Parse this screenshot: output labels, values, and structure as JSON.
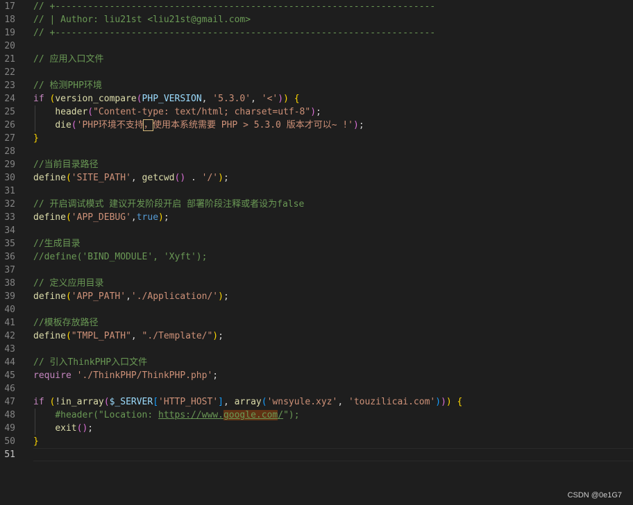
{
  "editor": {
    "watermark": "CSDN @0e1G7",
    "lines": [
      {
        "n": "17",
        "tokens": [
          [
            "c",
            "// +----------------------------------------------------------------------"
          ]
        ]
      },
      {
        "n": "18",
        "tokens": [
          [
            "c",
            "// | Author: liu21st <liu21st@gmail.com>"
          ]
        ]
      },
      {
        "n": "19",
        "tokens": [
          [
            "c",
            "// +----------------------------------------------------------------------"
          ]
        ]
      },
      {
        "n": "20",
        "tokens": []
      },
      {
        "n": "21",
        "tokens": [
          [
            "c",
            "// 应用入口文件"
          ]
        ]
      },
      {
        "n": "22",
        "tokens": []
      },
      {
        "n": "23",
        "tokens": [
          [
            "c",
            "// 检测PHP环境"
          ]
        ]
      },
      {
        "n": "24",
        "tokens": [
          [
            "k",
            "if"
          ],
          [
            "p",
            " "
          ],
          [
            "b1",
            "("
          ],
          [
            "f",
            "version_compare"
          ],
          [
            "b2",
            "("
          ],
          [
            "v",
            "PHP_VERSION"
          ],
          [
            "p",
            ", "
          ],
          [
            "s",
            "'5.3.0'"
          ],
          [
            "p",
            ", "
          ],
          [
            "s",
            "'<'"
          ],
          [
            "b2",
            ")"
          ],
          [
            "b1",
            ")"
          ],
          [
            "p",
            " "
          ],
          [
            "b1",
            "{"
          ]
        ]
      },
      {
        "n": "25",
        "guide": true,
        "tokens": [
          [
            "p",
            "    "
          ],
          [
            "f",
            "header"
          ],
          [
            "b2",
            "("
          ],
          [
            "s",
            "\"Content-type: text/html; charset=utf-8\""
          ],
          [
            "b2",
            ")"
          ],
          [
            "p",
            ";"
          ]
        ]
      },
      {
        "n": "26",
        "guide": true,
        "tokens": [
          [
            "p",
            "    "
          ],
          [
            "f",
            "die"
          ],
          [
            "b2",
            "("
          ],
          [
            "s",
            "'PHP环境不支持"
          ],
          [
            "s selbox",
            "，"
          ],
          [
            "s",
            "使用本系统需要 PHP > 5.3.0 版本才可以~ !'"
          ],
          [
            "b2",
            ")"
          ],
          [
            "p",
            ";"
          ]
        ]
      },
      {
        "n": "27",
        "tokens": [
          [
            "b1",
            "}"
          ]
        ]
      },
      {
        "n": "28",
        "tokens": []
      },
      {
        "n": "29",
        "tokens": [
          [
            "c",
            "//当前目录路径"
          ]
        ]
      },
      {
        "n": "30",
        "tokens": [
          [
            "f",
            "define"
          ],
          [
            "b1",
            "("
          ],
          [
            "s",
            "'SITE_PATH'"
          ],
          [
            "p",
            ", "
          ],
          [
            "f",
            "getcwd"
          ],
          [
            "b2",
            "()"
          ],
          [
            "p",
            " . "
          ],
          [
            "s",
            "'/'"
          ],
          [
            "b1",
            ")"
          ],
          [
            "p",
            ";"
          ]
        ]
      },
      {
        "n": "31",
        "tokens": []
      },
      {
        "n": "32",
        "tokens": [
          [
            "c",
            "// 开启调试模式 建议开发阶段开启 部署阶段注释或者设为false"
          ]
        ]
      },
      {
        "n": "33",
        "tokens": [
          [
            "f",
            "define"
          ],
          [
            "b1",
            "("
          ],
          [
            "s",
            "'APP_DEBUG'"
          ],
          [
            "p",
            ","
          ],
          [
            "kb",
            "true"
          ],
          [
            "b1",
            ")"
          ],
          [
            "p",
            ";"
          ]
        ]
      },
      {
        "n": "34",
        "tokens": []
      },
      {
        "n": "35",
        "tokens": [
          [
            "c",
            "//生成目录"
          ]
        ]
      },
      {
        "n": "36",
        "tokens": [
          [
            "c",
            "//define('BIND_MODULE', 'Xyft');"
          ]
        ]
      },
      {
        "n": "37",
        "tokens": []
      },
      {
        "n": "38",
        "tokens": [
          [
            "c",
            "// 定义应用目录"
          ]
        ]
      },
      {
        "n": "39",
        "tokens": [
          [
            "f",
            "define"
          ],
          [
            "b1",
            "("
          ],
          [
            "s",
            "'APP_PATH'"
          ],
          [
            "p",
            ","
          ],
          [
            "s",
            "'./Application/'"
          ],
          [
            "b1",
            ")"
          ],
          [
            "p",
            ";"
          ]
        ]
      },
      {
        "n": "40",
        "tokens": []
      },
      {
        "n": "41",
        "tokens": [
          [
            "c",
            "//模板存放路径"
          ]
        ]
      },
      {
        "n": "42",
        "tokens": [
          [
            "f",
            "define"
          ],
          [
            "b1",
            "("
          ],
          [
            "s",
            "\"TMPL_PATH\""
          ],
          [
            "p",
            ", "
          ],
          [
            "s",
            "\"./Template/\""
          ],
          [
            "b1",
            ")"
          ],
          [
            "p",
            ";"
          ]
        ]
      },
      {
        "n": "43",
        "tokens": []
      },
      {
        "n": "44",
        "tokens": [
          [
            "c",
            "// 引入ThinkPHP入口文件"
          ]
        ]
      },
      {
        "n": "45",
        "tokens": [
          [
            "k",
            "require"
          ],
          [
            "p",
            " "
          ],
          [
            "s",
            "'./ThinkPHP/ThinkPHP.php'"
          ],
          [
            "p",
            ";"
          ]
        ]
      },
      {
        "n": "46",
        "tokens": []
      },
      {
        "n": "47",
        "tokens": [
          [
            "k",
            "if"
          ],
          [
            "p",
            " "
          ],
          [
            "b1",
            "("
          ],
          [
            "p",
            "!"
          ],
          [
            "f",
            "in_array"
          ],
          [
            "b2",
            "("
          ],
          [
            "v",
            "$_SERVER"
          ],
          [
            "b3",
            "["
          ],
          [
            "s",
            "'HTTP_HOST'"
          ],
          [
            "b3",
            "]"
          ],
          [
            "p",
            ", "
          ],
          [
            "f",
            "array"
          ],
          [
            "b3",
            "("
          ],
          [
            "s",
            "'wnsyule.xyz'"
          ],
          [
            "p",
            ", "
          ],
          [
            "s",
            "'touzilicai.com'"
          ],
          [
            "b3",
            ")"
          ],
          [
            "b2",
            ")"
          ],
          [
            "b1",
            ")"
          ],
          [
            "p",
            " "
          ],
          [
            "b1",
            "{"
          ]
        ]
      },
      {
        "n": "48",
        "guide": true,
        "tokens": [
          [
            "p",
            "    "
          ],
          [
            "c",
            "#header(\"Location: "
          ],
          [
            "c u",
            "https://www."
          ],
          [
            "c u hl",
            "google.com"
          ],
          [
            "c u",
            "/"
          ],
          [
            "c",
            "\");"
          ]
        ]
      },
      {
        "n": "49",
        "guide": true,
        "tokens": [
          [
            "p",
            "    "
          ],
          [
            "f",
            "exit"
          ],
          [
            "b2",
            "()"
          ],
          [
            "p",
            ";"
          ]
        ]
      },
      {
        "n": "50",
        "tokens": [
          [
            "b1",
            "}"
          ]
        ]
      },
      {
        "n": "51",
        "current": true,
        "tokens": []
      }
    ]
  }
}
